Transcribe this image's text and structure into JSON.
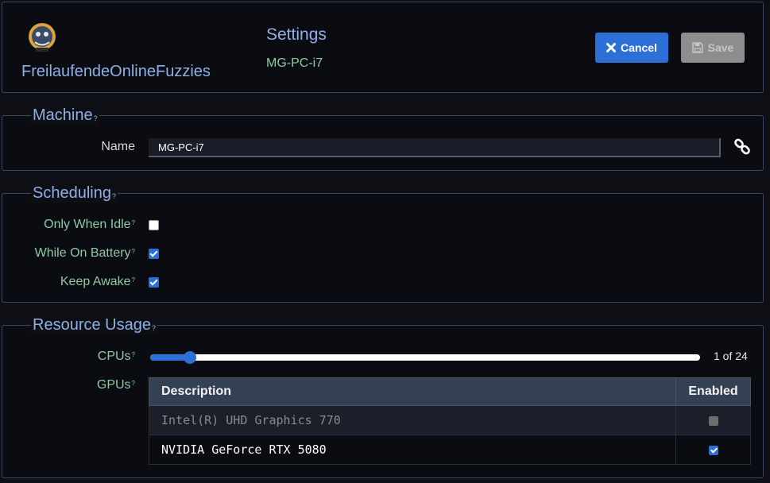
{
  "header": {
    "team_name": "FreilaufendeOnlineFuzzies",
    "title": "Settings",
    "machine_name": "MG-PC-i7",
    "cancel_label": "Cancel",
    "save_label": "Save",
    "logo_icon": "team-avatar-icon"
  },
  "machine": {
    "legend": "Machine",
    "help": "?",
    "name_label": "Name",
    "name_value": "MG-PC-i7",
    "link_icon": "link-icon"
  },
  "scheduling": {
    "legend": "Scheduling",
    "help": "?",
    "items": [
      {
        "label": "Only When Idle",
        "checked": false
      },
      {
        "label": "While On Battery",
        "checked": true
      },
      {
        "label": "Keep Awake",
        "checked": true
      }
    ]
  },
  "resource": {
    "legend": "Resource Usage",
    "help": "?",
    "cpus_label": "CPUs",
    "cpus_value": 1,
    "cpus_max": 24,
    "cpus_text": "1 of 24",
    "gpus_label": "GPUs",
    "gpu_columns": [
      "Description",
      "Enabled"
    ],
    "gpus": [
      {
        "description": "Intel(R) UHD Graphics 770",
        "enabled": false,
        "disabled": true
      },
      {
        "description": "NVIDIA GeForce RTX 5080",
        "enabled": true,
        "disabled": false
      }
    ]
  },
  "colors": {
    "accent": "#2c6fd6",
    "heading": "#8fb0e6",
    "label_green": "#8ec9a6",
    "background": "#0d0f14"
  }
}
